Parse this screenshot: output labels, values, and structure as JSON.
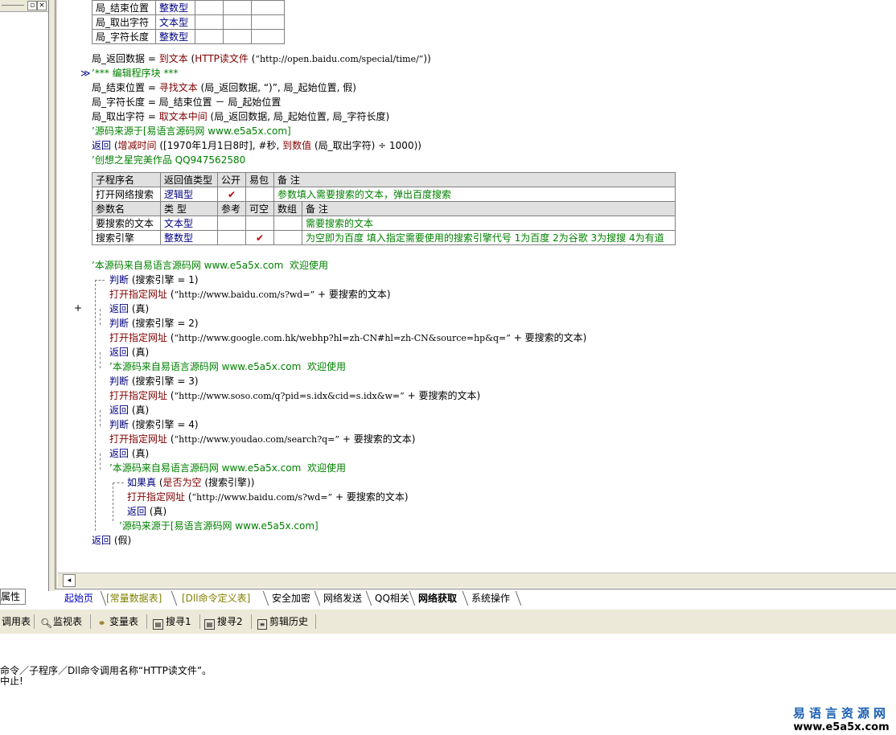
{
  "vars_table": [
    {
      "name": "局_结束位置",
      "type": "整数型"
    },
    {
      "name": "局_取出字符",
      "type": "文本型"
    },
    {
      "name": "局_字符长度",
      "type": "整数型"
    }
  ],
  "code_top": {
    "l1_a": "局_返回数据 = ",
    "l1_kw": "到文本",
    "l1_b": " (",
    "l1_kw2": "HTTP读文件",
    "l1_c": " (",
    "l1_str": "“http://open.baidu.com/special/time/”",
    "l1_d": "))",
    "l2": "’*** 编辑程序块 ***",
    "l3_a": "局_结束位置 = ",
    "l3_kw": "寻找文本",
    "l3_b": " (局_返回数据, “)”, 局_起始位置, 假)",
    "l4": "局_字符长度 = 局_结束位置 － 局_起始位置",
    "l5_a": "局_取出字符 = ",
    "l5_kw": "取文本中间",
    "l5_b": " (局_返回数据, 局_起始位置, 局_字符长度)",
    "l6": "’源码来源于[易语言源码网 www.e5a5x.com]",
    "l7_kw": "返回",
    "l7_a": " (",
    "l7_kw2": "增减时间",
    "l7_b": " ([1970年1月1日8时], #秒, ",
    "l7_kw3": "到数值",
    "l7_c": " (局_取出字符) ÷ 1000))",
    "l8": "’创想之星完美作品 QQ947562580"
  },
  "sub_table": {
    "headers": [
      "子程序名",
      "返回值类型",
      "公开",
      "易包",
      "备 注"
    ],
    "row": {
      "name": "打开网络搜索",
      "type": "逻辑型",
      "public": "✔",
      "note": "参数填入需要搜索的文本，弹出百度搜索"
    },
    "param_headers": [
      "参数名",
      "类 型",
      "参考",
      "可空",
      "数组",
      "备 注"
    ],
    "params": [
      {
        "name": "要搜索的文本",
        "type": "文本型",
        "ref": "",
        "nullable": "",
        "arr": "",
        "note": "需要搜索的文本"
      },
      {
        "name": "搜索引擎",
        "type": "整数型",
        "ref": "",
        "nullable": "✔",
        "arr": "",
        "note": "为空即为百度 填入指定需要使用的搜索引擎代号 1为百度 2为谷歌 3为搜搜 4为有道"
      }
    ]
  },
  "code_body": {
    "c1": "’本源码来自易语言源码网 www.e5a5x.com  欢迎使用",
    "judge": "判断",
    "j1": " (搜索引擎 = 1)",
    "open": "打开指定网址",
    "u1_str": "“http://www.baidu.com/s?wd=”",
    "u1_b": " + 要搜索的文本)",
    "ret": "返回",
    "ret_true": " (真)",
    "j2": " (搜索引擎 = 2)",
    "u2_str": "“http://www.google.com.hk/webhp?hl=zh-CN#hl=zh-CN&source=hp&q=”",
    "u2_b": " + 要搜索的文本)",
    "c2": "’本源码来自易语言源码网 www.e5a5x.com  欢迎使用",
    "j3": " (搜索引擎 = 3)",
    "u3_str": "“http://www.soso.com/q?pid=s.idx&cid=s.idx&w=”",
    "u3_b": " + 要搜索的文本)",
    "j4": " (搜索引擎 = 4)",
    "u4_str": "“http://www.youdao.com/search?q=”",
    "u4_b": " + 要搜索的文本)",
    "c3": "’本源码来自易语言源码网 www.e5a5x.com  欢迎使用",
    "iftrue": "如果真",
    "if_a": " (",
    "if_kw": "是否为空",
    "if_b": " (搜索引擎))",
    "u5_str": "“http://www.baidu.com/s?wd=”",
    "u5_b": " + 要搜索的文本)",
    "c4": "’源码来源于[易语言源码网 www.e5a5x.com]",
    "ret_false": " (假)",
    "paren": " ("
  },
  "gutter_marks": {
    "arrow": "≫",
    "plus": "+"
  },
  "tabs": [
    {
      "label": "起始页",
      "style": "blue"
    },
    {
      "label": "[常量数据表]",
      "style": "yellow"
    },
    {
      "label": "[Dll命令定义表]",
      "style": "yellow"
    },
    {
      "label": "安全加密",
      "style": "normal"
    },
    {
      "label": "网络发送",
      "style": "normal"
    },
    {
      "label": "QQ相关",
      "style": "normal"
    },
    {
      "label": "网络获取",
      "style": "active"
    },
    {
      "label": "系统操作",
      "style": "normal"
    }
  ],
  "props_tab": "属性",
  "toolbar": [
    {
      "label": "调用表",
      "icon": "call-table-icon"
    },
    {
      "label": "监视表",
      "icon": "magnifier-icon"
    },
    {
      "label": "变量表",
      "icon": "variables-icon"
    },
    {
      "label": "搜寻1",
      "icon": "search1-icon"
    },
    {
      "label": "搜寻2",
      "icon": "search2-icon"
    },
    {
      "label": "剪辑历史",
      "icon": "clip-history-icon"
    }
  ],
  "output": {
    "line1": "命令／子程序／Dll命令调用名称“HTTP读文件”。",
    "line2": "中止!"
  },
  "watermark": {
    "title": "易语言资源网",
    "url": "www.e5a5x.com"
  }
}
